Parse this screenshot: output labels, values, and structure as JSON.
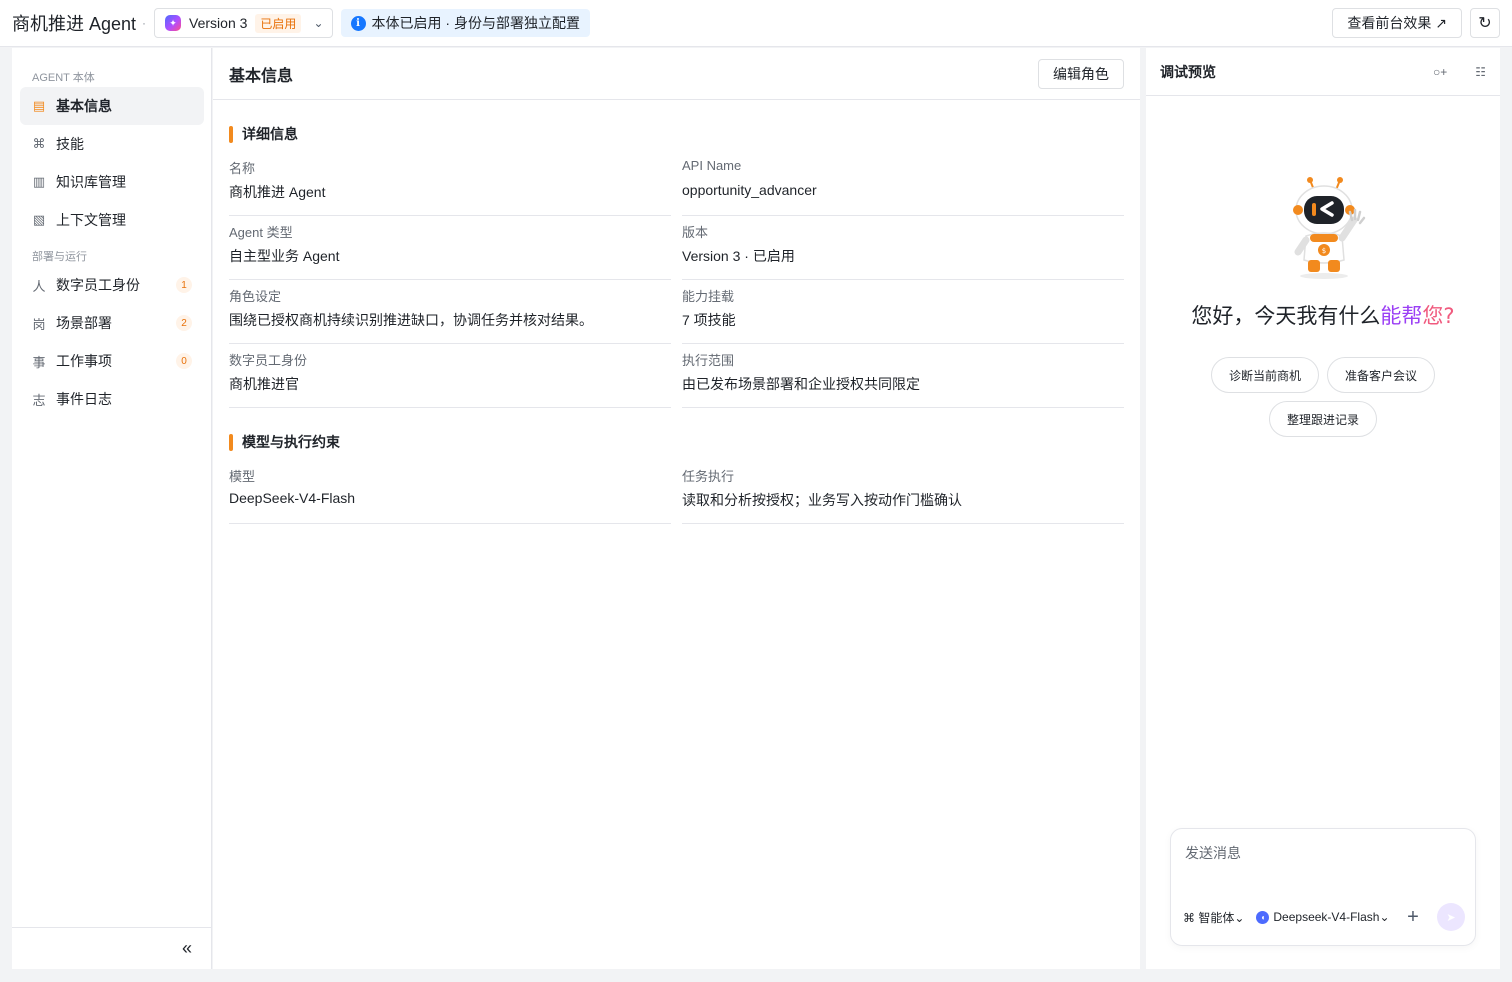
{
  "header": {
    "app_title": "商机推进 Agent",
    "separator": "·",
    "version_label": "Version 3",
    "version_status": "已启用",
    "info_text": "本体已启用 · 身份与部署独立配置",
    "preview_button": "查看前台效果 ↗",
    "refresh_icon": "refresh-icon"
  },
  "sidebar": {
    "group1": "AGENT 本体",
    "items1": [
      {
        "label": "基本信息",
        "icon": "▤"
      },
      {
        "label": "技能",
        "icon": "⌘"
      },
      {
        "label": "知识库管理",
        "icon": "▥"
      },
      {
        "label": "上下文管理",
        "icon": "▧"
      }
    ],
    "group2": "部署与运行",
    "items2": [
      {
        "label": "数字员工身份",
        "icon": "人",
        "count": "1"
      },
      {
        "label": "场景部署",
        "icon": "岗",
        "count": "2"
      },
      {
        "label": "工作事项",
        "icon": "事",
        "count": "0"
      },
      {
        "label": "事件日志",
        "icon": "志"
      }
    ],
    "collapse": "«"
  },
  "main": {
    "title": "基本信息",
    "edit_button": "编辑角色",
    "section1": "详细信息",
    "fields1": [
      {
        "label": "名称",
        "value": "商机推进 Agent"
      },
      {
        "label": "API Name",
        "value": "opportunity_advancer"
      },
      {
        "label": "Agent 类型",
        "value": "自主型业务 Agent"
      },
      {
        "label": "版本",
        "value": "Version 3 · 已启用"
      },
      {
        "label": "角色设定",
        "value": "围绕已授权商机持续识别推进缺口，协调任务并核对结果。"
      },
      {
        "label": "能力挂载",
        "value": "7 项技能"
      },
      {
        "label": "数字员工身份",
        "value": "商机推进官"
      },
      {
        "label": "执行范围",
        "value": "由已发布场景部署和企业授权共同限定"
      }
    ],
    "section2": "模型与执行约束",
    "fields2": [
      {
        "label": "模型",
        "value": "DeepSeek-V4-Flash"
      },
      {
        "label": "任务执行",
        "value": "读取和分析按授权；业务写入按动作门槛确认"
      }
    ]
  },
  "preview": {
    "title": "调试预览",
    "new_chat_icon": "○+",
    "list_icon": "☷",
    "greeting_a": "您好，今天我有什么",
    "greeting_b": "能帮",
    "greeting_c": "您?",
    "chips": [
      "诊断当前商机",
      "准备客户会议",
      "整理跟进记录"
    ],
    "input_placeholder": "发送消息",
    "agent_selector": "⌘ 智能体⌄",
    "model_selector": "Deepseek-V4-Flash⌄",
    "plus": "+",
    "send": "➤"
  },
  "colors": {
    "accent": "#f28a1e",
    "info": "#1677ff",
    "greeting_highlight": "#9b3ff5"
  }
}
